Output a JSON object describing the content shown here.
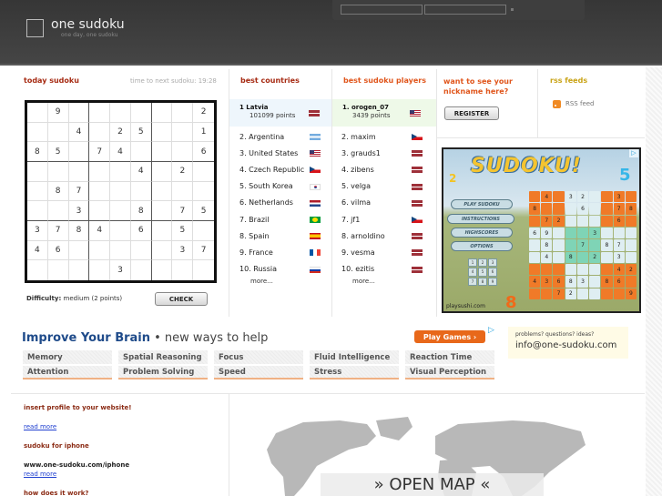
{
  "header": {
    "logo_title": "one sudoku",
    "logo_subtitle": "one day, one sudoku"
  },
  "sudoku": {
    "title": "today sudoku",
    "timer": "time to next sudoku: 19:28",
    "grid": [
      [
        "",
        "9",
        "",
        "",
        "",
        "",
        "",
        "",
        "2"
      ],
      [
        "",
        "",
        "4",
        "",
        "2",
        "5",
        "",
        "",
        "1"
      ],
      [
        "8",
        "5",
        "",
        "7",
        "4",
        "",
        "",
        "",
        "6"
      ],
      [
        "",
        "",
        "",
        "",
        "",
        "4",
        "",
        "2",
        ""
      ],
      [
        "",
        "8",
        "7",
        "",
        "",
        "",
        "",
        "",
        ""
      ],
      [
        "",
        "",
        "3",
        "",
        "",
        "8",
        "",
        "7",
        "5"
      ],
      [
        "3",
        "7",
        "8",
        "4",
        "",
        "6",
        "",
        "5",
        ""
      ],
      [
        "4",
        "6",
        "",
        "",
        "",
        "",
        "",
        "3",
        "7"
      ],
      [
        "",
        "",
        "",
        "",
        "3",
        "",
        "",
        "",
        ""
      ]
    ],
    "difficulty_label": "Difficulty:",
    "difficulty_value": "medium (2 points)",
    "check_label": "CHECK"
  },
  "countries": {
    "title": "best countries",
    "top": {
      "name": "1 Latvia",
      "points": "101099 points",
      "flag": "lv"
    },
    "items": [
      {
        "label": "2.  Argentina",
        "flag": "ar"
      },
      {
        "label": "3.  United States",
        "flag": "us"
      },
      {
        "label": "4.  Czech Republic",
        "flag": "cz"
      },
      {
        "label": "5.  South Korea",
        "flag": "kr"
      },
      {
        "label": "6.  Netherlands",
        "flag": "nl"
      },
      {
        "label": "7.  Brazil",
        "flag": "br"
      },
      {
        "label": "8.  Spain",
        "flag": "es"
      },
      {
        "label": "9.  France",
        "flag": "fr"
      },
      {
        "label": "10.  Russia",
        "flag": "ru"
      }
    ],
    "more": "more..."
  },
  "players": {
    "title": "best sudoku players",
    "top": {
      "name": "1. orogen_07",
      "points": "3439 points",
      "flag": "us"
    },
    "items": [
      {
        "label": "2.  maxim",
        "flag": "cz"
      },
      {
        "label": "3.  grauds1",
        "flag": "lv"
      },
      {
        "label": "4.  zibens",
        "flag": "lv"
      },
      {
        "label": "5.  velga",
        "flag": "lv"
      },
      {
        "label": "6.  vilma",
        "flag": "lv"
      },
      {
        "label": "7.  jf1",
        "flag": "cz"
      },
      {
        "label": "8.  arnoldino",
        "flag": "lv"
      },
      {
        "label": "9.  vesma",
        "flag": "lv"
      },
      {
        "label": "10.  ezitis",
        "flag": "lv"
      }
    ],
    "more": "more..."
  },
  "register": {
    "title_line1": "want to see your",
    "title_line2": "nickname here?",
    "button": "REGISTER"
  },
  "rss": {
    "title": "rss feeds",
    "link": "RSS feed"
  },
  "game_ad": {
    "title": "SUDOKU!",
    "menu": [
      "PLAY SUDOKU",
      "INSTRUCTIONS",
      "HIGHSCORES",
      "OPTIONS"
    ],
    "grid": [
      [
        "o",
        "4o",
        "o",
        "3l",
        "2l",
        "l",
        "o",
        "3o",
        "o"
      ],
      [
        "8o",
        "o",
        "o",
        "l",
        "6l",
        "l",
        "o",
        "7o",
        "8o"
      ],
      [
        "o",
        "7o",
        "2o",
        "l",
        "l",
        "l",
        "o",
        "6o",
        "o"
      ],
      [
        "6l",
        "9l",
        "l",
        "g",
        "g",
        "3g",
        "l",
        "l",
        "l"
      ],
      [
        "l",
        "8l",
        "l",
        "g",
        "7g",
        "g",
        "8l",
        "7l",
        "l"
      ],
      [
        "l",
        "4l",
        "l",
        "8g",
        "g",
        "2g",
        "l",
        "3l",
        "l"
      ],
      [
        "o",
        "o",
        "o",
        "l",
        "l",
        "l",
        "o",
        "4o",
        "2o"
      ],
      [
        "4o",
        "3o",
        "6o",
        "8l",
        "3l",
        "l",
        "8o",
        "6o",
        "o"
      ],
      [
        "o",
        "o",
        "7o",
        "2l",
        "l",
        "l",
        "o",
        "o",
        "9o"
      ]
    ],
    "keypad": [
      "1",
      "2",
      "3",
      "4",
      "5",
      "6",
      "7",
      "8",
      "9"
    ],
    "site": "playsushi.com",
    "deco_numbers": [
      "2",
      "5",
      "8"
    ]
  },
  "brain": {
    "title": "Improve Your Brain",
    "subtitle": " • new ways to help",
    "tags": [
      [
        "Memory",
        "Spatial Reasoning",
        "Focus",
        "Fluid Intelligence",
        "Reaction Time"
      ],
      [
        "Attention",
        "Problem Solving",
        "Speed",
        "Stress",
        "Visual Perception"
      ]
    ],
    "play_games": "Play Games ›"
  },
  "contact": {
    "question": "problems? questions? ideas?",
    "email": "info@one-sudoku.com"
  },
  "info": {
    "profile_title": "insert profile to your website!",
    "read_more": "read more",
    "iphone_title": "sudoku for iphone",
    "iphone_url": "www.one-sudoku.com/iphone",
    "how_title": "how does it work?"
  },
  "map": {
    "open_label": "» OPEN MAP «"
  }
}
